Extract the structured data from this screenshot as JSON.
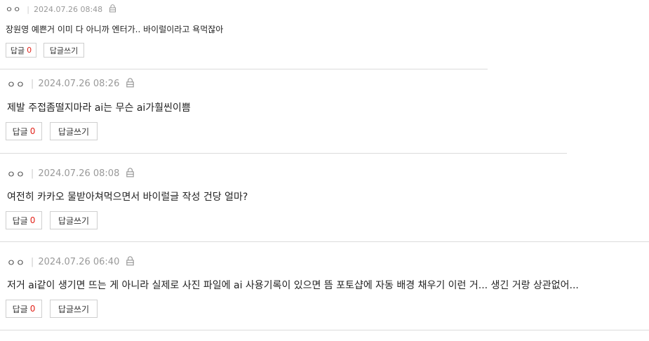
{
  "comments": [
    {
      "author": "ㅇㅇ",
      "datetime": "2024.07.26 08:48",
      "text": "장원영 예쁜거 이미 다 아니까 엔터가.. 바이럴이라고 욕먹잖아",
      "reply_label": "답글",
      "reply_count": "0",
      "write_reply_label": "답글쓰기"
    },
    {
      "author": "ㅇㅇ",
      "datetime": "2024.07.26 08:26",
      "text": "제발 주접좀떨지마라 ai는 무슨 ai가훨씬이쁨",
      "reply_label": "답글",
      "reply_count": "0",
      "write_reply_label": "답글쓰기"
    },
    {
      "author": "ㅇㅇ",
      "datetime": "2024.07.26 08:08",
      "text": "여전히 카카오 물받아쳐먹으면서 바이럴글 작성 건당 얼마?",
      "reply_label": "답글",
      "reply_count": "0",
      "write_reply_label": "답글쓰기"
    },
    {
      "author": "ㅇㅇ",
      "datetime": "2024.07.26 06:40",
      "text": "저거 ai같이 생기면 뜨는 게 아니라 실제로 사진 파일에 ai 사용기록이 있으면 뜸 포토샵에 자동 배경 채우기 이런 거... 생긴 거랑 상관없어...",
      "reply_label": "답글",
      "reply_count": "0",
      "write_reply_label": "답글쓰기"
    }
  ],
  "icons": {
    "lock": "lock-icon"
  },
  "colors": {
    "reply_count": "#e2231a",
    "meta": "#999999",
    "border": "#cfcfcf"
  }
}
